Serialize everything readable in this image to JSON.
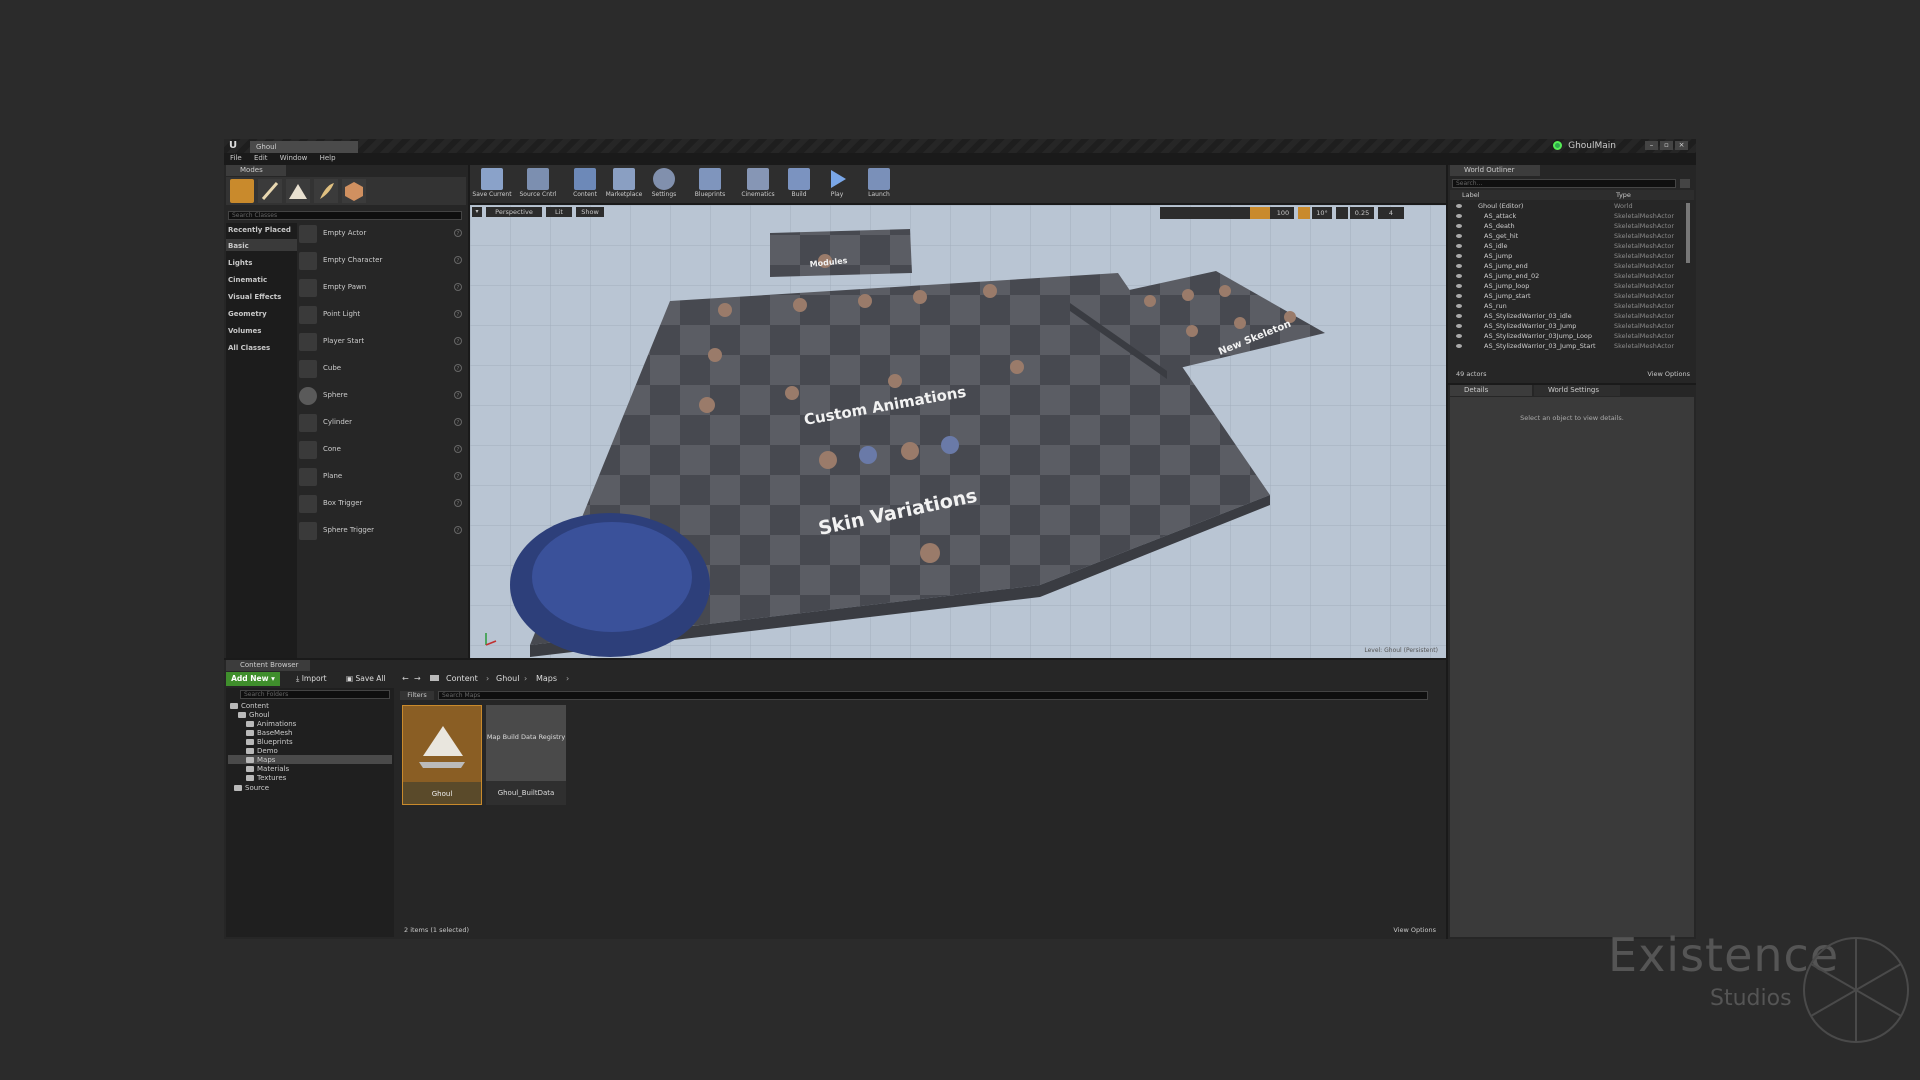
{
  "app": {
    "document_tab": "Ghoul",
    "project_name": "GhoulMain",
    "menu": [
      "File",
      "Edit",
      "Window",
      "Help"
    ],
    "window_buttons": [
      "–",
      "▫",
      "×"
    ]
  },
  "modes": {
    "tab": "Modes",
    "search_placeholder": "Search Classes",
    "categories": [
      "Recently Placed",
      "Basic",
      "Lights",
      "Cinematic",
      "Visual Effects",
      "Geometry",
      "Volumes",
      "All Classes"
    ],
    "selected_category": "Basic",
    "classes": [
      "Empty Actor",
      "Empty Character",
      "Empty Pawn",
      "Point Light",
      "Player Start",
      "Cube",
      "Sphere",
      "Cylinder",
      "Cone",
      "Plane",
      "Box Trigger",
      "Sphere Trigger"
    ]
  },
  "toolbar": {
    "buttons": [
      "Save Current",
      "Source Cntrl",
      "Content",
      "Marketplace",
      "Settings",
      "Blueprints",
      "Cinematics",
      "Build",
      "Play",
      "Launch"
    ]
  },
  "viewport": {
    "view_mode": "Perspective",
    "lighting": "Lit",
    "show": "Show",
    "grid_snap": "100",
    "rotation_snap": "10°",
    "scale_snap": "0.25",
    "camera_speed": "4",
    "labels": {
      "modules": "Modules",
      "custom_animations": "Custom Animations",
      "skin_variations": "Skin Variations",
      "new_skeleton": "New Skeleton"
    },
    "level_prefix": "Level:",
    "level_name": "Ghoul (Persistent)"
  },
  "world_outliner": {
    "tab": "World Outliner",
    "search_placeholder": "Search...",
    "col_label": "Label",
    "col_type": "Type",
    "rows": [
      {
        "label": "Ghoul (Editor)",
        "type": "World"
      },
      {
        "label": "AS_attack",
        "type": "SkeletalMeshActor"
      },
      {
        "label": "AS_death",
        "type": "SkeletalMeshActor"
      },
      {
        "label": "AS_get_hit",
        "type": "SkeletalMeshActor"
      },
      {
        "label": "AS_idle",
        "type": "SkeletalMeshActor"
      },
      {
        "label": "AS_jump",
        "type": "SkeletalMeshActor"
      },
      {
        "label": "AS_jump_end",
        "type": "SkeletalMeshActor"
      },
      {
        "label": "AS_jump_end_02",
        "type": "SkeletalMeshActor"
      },
      {
        "label": "AS_jump_loop",
        "type": "SkeletalMeshActor"
      },
      {
        "label": "AS_jump_start",
        "type": "SkeletalMeshActor"
      },
      {
        "label": "AS_run",
        "type": "SkeletalMeshActor"
      },
      {
        "label": "AS_StylizedWarrior_03_idle",
        "type": "SkeletalMeshActor"
      },
      {
        "label": "AS_StylizedWarrior_03_Jump",
        "type": "SkeletalMeshActor"
      },
      {
        "label": "AS_StylizedWarrior_03Jump_Loop",
        "type": "SkeletalMeshActor"
      },
      {
        "label": "AS_StylizedWarrior_03_Jump_Start",
        "type": "SkeletalMeshActor"
      }
    ],
    "actor_count": "49 actors",
    "view_options": "View Options"
  },
  "details": {
    "tab_details": "Details",
    "tab_world_settings": "World Settings",
    "empty_message": "Select an object to view details."
  },
  "content_browser": {
    "tab": "Content Browser",
    "add_new": "Add New",
    "import": "Import",
    "save_all": "Save All",
    "breadcrumbs": [
      "Content",
      "Ghoul",
      "Maps"
    ],
    "search_folders_placeholder": "Search Folders",
    "filters": "Filters",
    "search_assets_placeholder": "Search Maps",
    "tree": {
      "root": "Content",
      "ghoul": "Ghoul",
      "children": [
        "Animations",
        "BaseMesh",
        "Blueprints",
        "Demo",
        "Maps",
        "Materials",
        "Textures"
      ],
      "selected": "Maps",
      "source": "Source"
    },
    "assets": [
      {
        "name": "Ghoul",
        "thumb_text": ""
      },
      {
        "name": "Ghoul_BuiltData",
        "thumb_text": "Map Build Data Registry"
      }
    ],
    "status": "2 items (1 selected)",
    "view_options": "View Options"
  },
  "watermark": {
    "line1": "Existence",
    "line2": "Studios"
  },
  "colors": {
    "background": "#2b2b2b",
    "editor_bg": "#1a1a1a",
    "panel": "#262626",
    "accent_orange": "#c98a2c",
    "add_new_green": "#3f8e2c",
    "selected_asset": "#5a4a2a"
  }
}
